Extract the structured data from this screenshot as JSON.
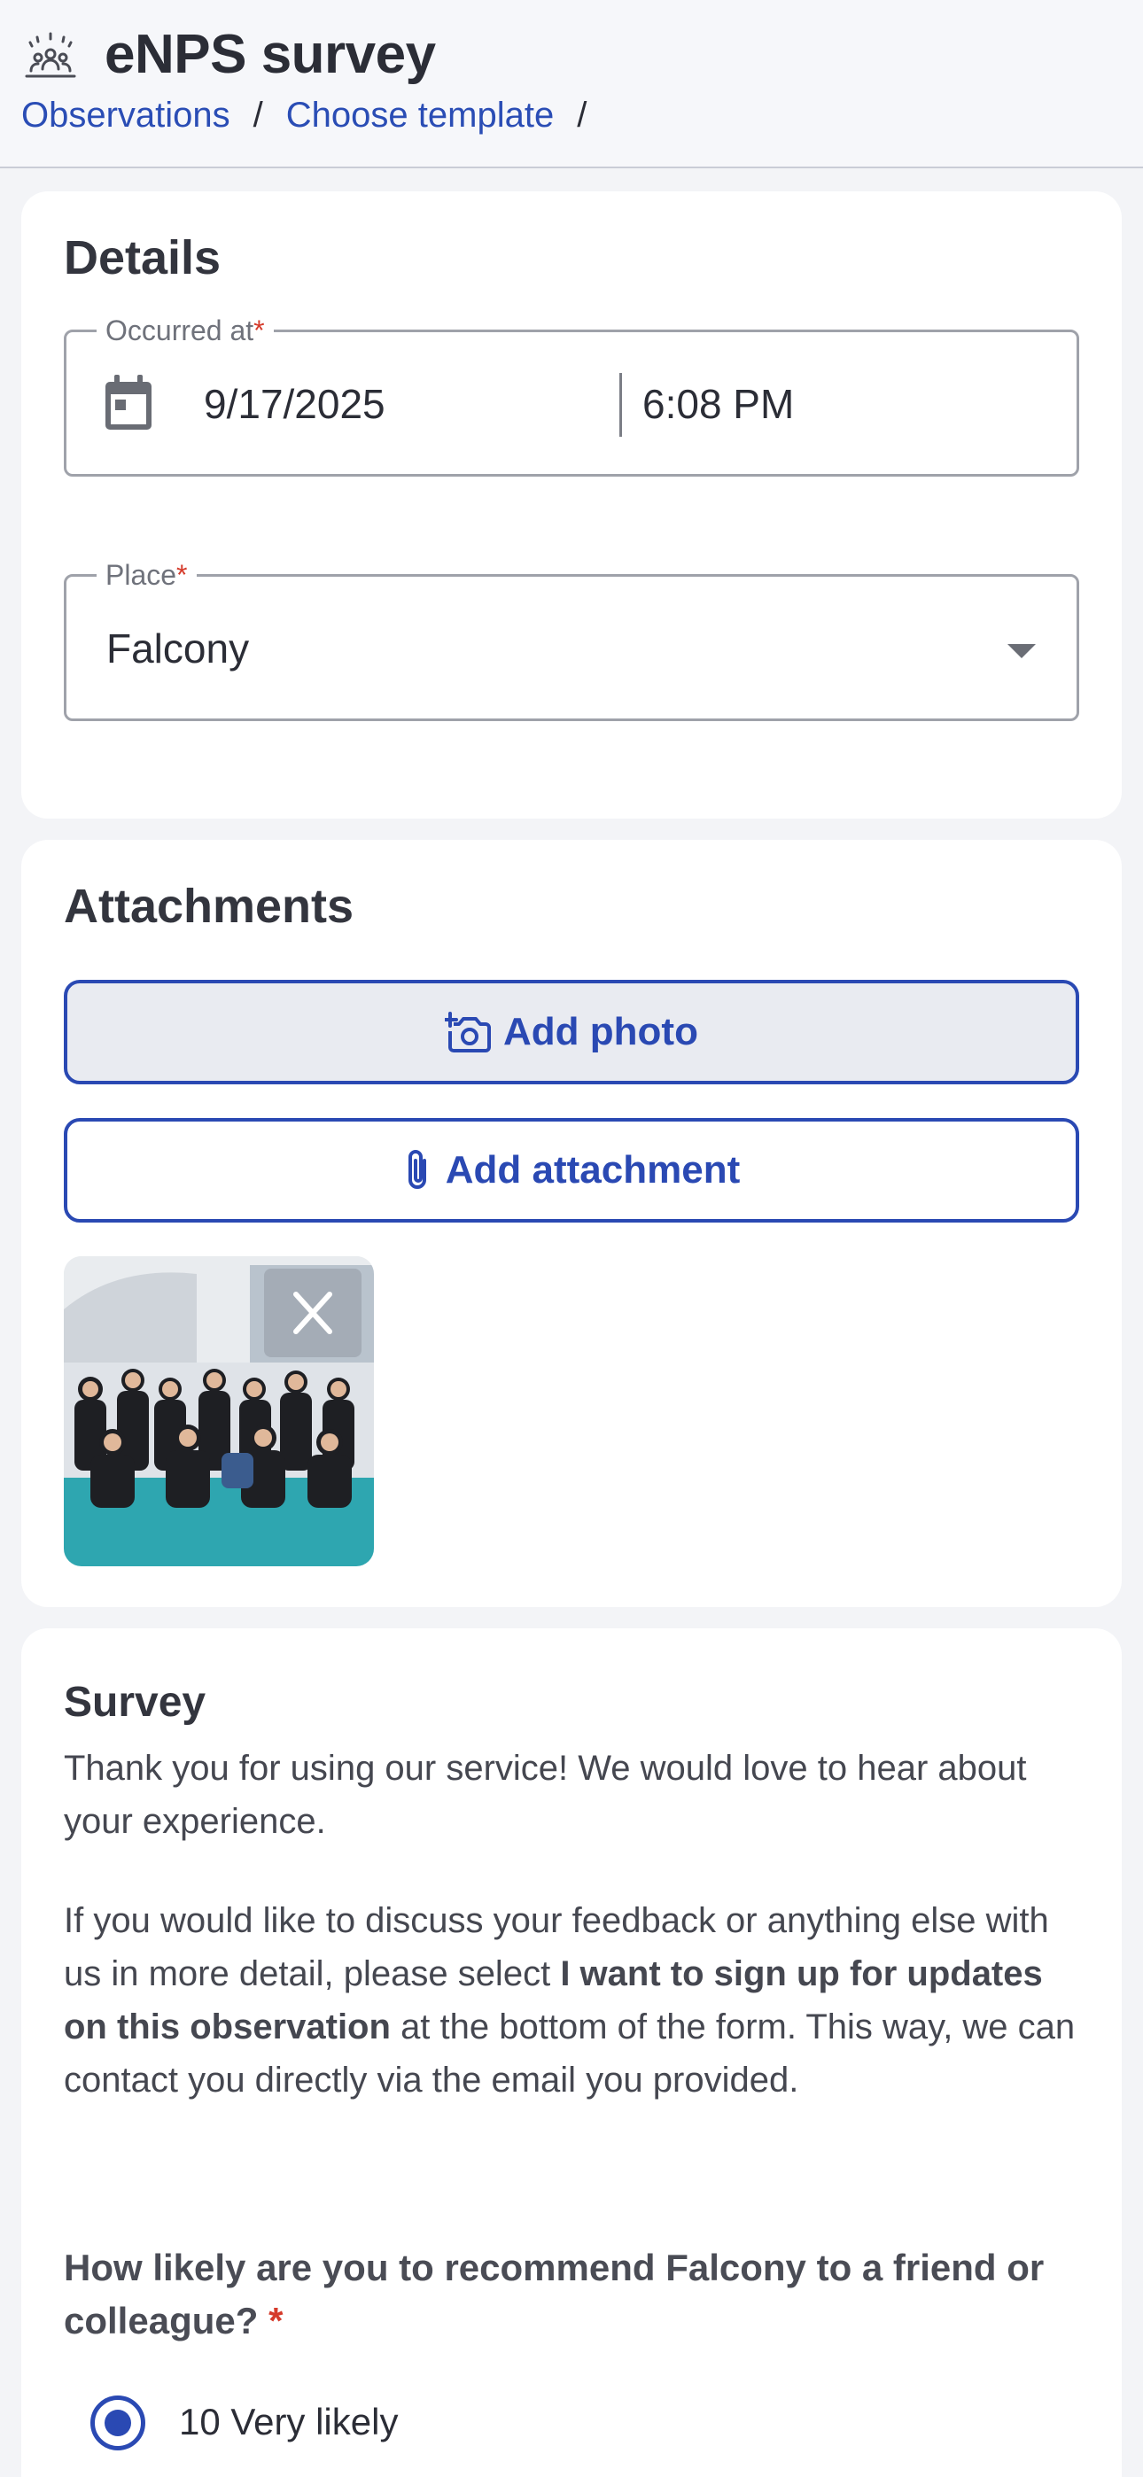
{
  "header": {
    "title": "eNPS survey",
    "logo_icon": "people-group-icon",
    "breadcrumbs": [
      "Observations",
      "Choose template"
    ],
    "separator": "/"
  },
  "details": {
    "title": "Details",
    "occurred_at": {
      "label": "Occurred at",
      "required_mark": "*",
      "date": "9/17/2025",
      "time": "6:08 PM",
      "icon": "calendar-icon"
    },
    "place": {
      "label": "Place",
      "required_mark": "*",
      "value": "Falcony",
      "icon": "dropdown-caret-icon"
    }
  },
  "attachments": {
    "title": "Attachments",
    "add_photo": "Add photo",
    "add_attachment": "Add attachment",
    "photo_remove_icon": "close-icon"
  },
  "survey": {
    "title": "Survey",
    "intro": "Thank you for using our service! We would love to hear about your experience.",
    "para_before": "If you would like to discuss your feedback or anything else with us in more detail, please select",
    "para_bold": "I want to sign up for updates on this observation",
    "para_after": "at the bottom of the form. This way, we can contact you directly via the email you provided.",
    "question": "How likely are you to recommend Falcony to a friend or colleague?",
    "required_mark": "*",
    "selected_option": "10 Very likely"
  },
  "colors": {
    "accent": "#2a49b3",
    "required": "#d53b2b",
    "background": "#f3f4f7"
  }
}
